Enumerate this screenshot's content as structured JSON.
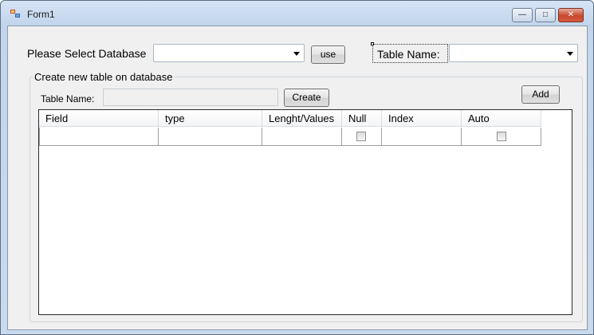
{
  "window": {
    "title": "Form1",
    "minimize_glyph": "—",
    "maximize_glyph": "□",
    "close_glyph": "✕"
  },
  "top": {
    "select_db_label": "Please Select Database",
    "db_combo_value": "",
    "use_button": "use",
    "table_name_label": "Table Name:",
    "table_combo_value": ""
  },
  "create_group": {
    "title": "Create new table on database",
    "table_name_label": "Table Name:",
    "table_name_value": "",
    "create_button": "Create",
    "add_button": "Add"
  },
  "grid": {
    "columns": [
      "Field",
      "type",
      "Lenght/Values",
      "Null",
      "Index",
      "Auto"
    ],
    "rows": [
      {
        "field": "",
        "type": "",
        "length": "",
        "null": false,
        "index": "",
        "auto": false
      }
    ]
  },
  "icons": {
    "app": "form-icon",
    "dropdown": "chevron-down-icon"
  }
}
